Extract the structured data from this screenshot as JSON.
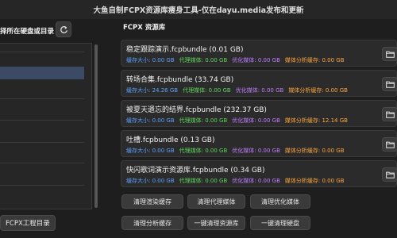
{
  "window": {
    "title": "大鱼自制FCPX资源库瘦身工具-仅在dayu.media发布和更新"
  },
  "left": {
    "header": "择所在硬盘或目录",
    "refresh_icon": "refresh-icon",
    "bottom_button": "FCPX工程目录"
  },
  "right": {
    "header": "FCPX 资源库",
    "folder_icon": "folder-icon",
    "stat_labels": {
      "cache": "缓存大小",
      "proxy": "代理媒体",
      "optimized": "优化媒体",
      "analysis": "媒体分析缓存"
    },
    "bundles": [
      {
        "name": "稳定跟踪演示.fcpbundle (0.01 GB)",
        "cache": "缓存大小: 0.00 GB",
        "proxy": "代理媒体: 0.00 GB",
        "optimized": "优化媒体: 0.00 GB",
        "analysis": "媒体分析缓存: 0.00 GB"
      },
      {
        "name": "转场合集.fcpbundle (33.74 GB)",
        "cache": "缓存大小: 24.26 GB",
        "proxy": "代理媒体: 0.00 GB",
        "optimized": "优化媒体: 0.00 GB",
        "analysis": "媒体分析缓存: 0.00 GB"
      },
      {
        "name": "被夏天遗忘的结界.fcpbundle (232.37 GB)",
        "cache": "缓存大小: 0.00 GB",
        "proxy": "代理媒体: 0.00 GB",
        "optimized": "优化媒体: 0.00 GB",
        "analysis": "媒体分析缓存: 12.14 GB"
      },
      {
        "name": "吐槽.fcpbundle (0.13 GB)",
        "cache": "缓存大小: 0.00 GB",
        "proxy": "代理媒体: 0.00 GB",
        "optimized": "优化媒体: 0.00 GB",
        "analysis": "媒体分析缓存: 0.00 GB"
      },
      {
        "name": "快闪歌词演示资源库.fcpbundle (0.34 GB)",
        "cache": "缓存大小: 0.00 GB",
        "proxy": "代理媒体: 0.00 GB",
        "optimized": "优化媒体: 0.00 GB",
        "analysis": "媒体分析缓存: 0.00 GB"
      }
    ]
  },
  "actions": {
    "clear_render": "清理渲染缓存",
    "clear_proxy": "清理代理媒体",
    "clear_optimized": "清理优化媒体",
    "clear_analysis": "清理分析缓存",
    "clear_library": "一键清理资源库",
    "clear_disk": "一键清理硬盘"
  },
  "colors": {
    "cache": "#5aa0ff",
    "proxy": "#5cd65c",
    "optimized": "#c07cff",
    "analysis": "#ffa63d",
    "selected_row": "#3c4a63"
  }
}
